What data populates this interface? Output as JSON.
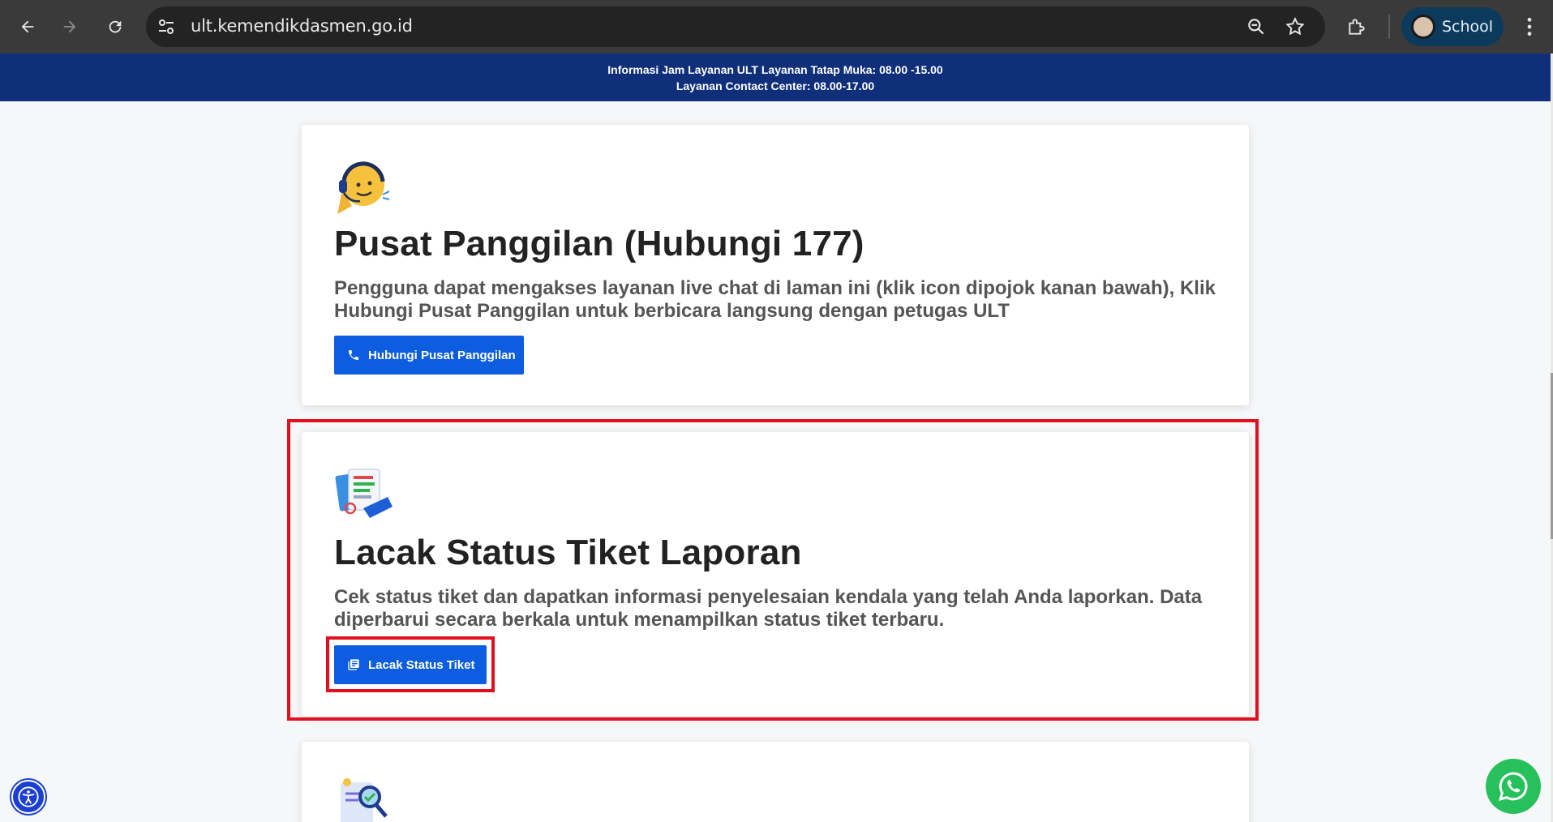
{
  "browser": {
    "url": "ult.kemendikdasmen.go.id",
    "profile_name": "School"
  },
  "banner": {
    "line1": "Informasi Jam Layanan ULT Layanan Tatap Muka: 08.00 -15.00",
    "line2": "Layanan Contact Center: 08.00-17.00"
  },
  "cards": [
    {
      "icon": "call-center-headset-emoji",
      "title": "Pusat Panggilan (Hubungi 177)",
      "description": "Pengguna dapat mengakses layanan live chat di laman ini (klik icon dipojok kanan bawah), Klik Hubungi Pusat Panggilan untuk berbicara langsung dengan petugas ULT",
      "button_label": "Hubungi Pusat Panggilan",
      "button_icon": "phone-icon"
    },
    {
      "icon": "ticket-documents-illustration",
      "title": "Lacak Status Tiket Laporan",
      "description": "Cek status tiket dan dapatkan informasi penyelesaian kendala yang telah Anda laporkan. Data diperbarui secara berkala untuk menampilkan status tiket terbaru.",
      "button_label": "Lacak Status Tiket",
      "button_icon": "library-books-icon"
    },
    {
      "icon": "document-search-illustration"
    }
  ],
  "colors": {
    "banner_bg": "#0f2f7a",
    "button_bg": "#0d5de0",
    "highlight": "#e0101e",
    "whatsapp": "#27c15b",
    "accessibility": "#1b3fd1"
  }
}
